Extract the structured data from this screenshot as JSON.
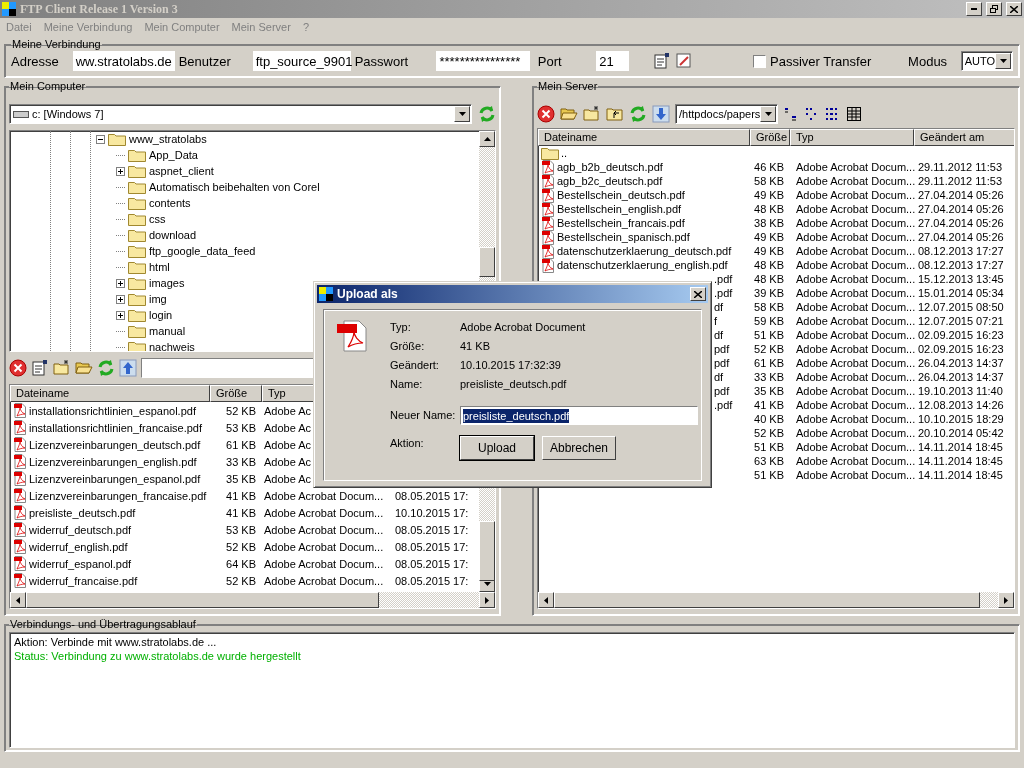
{
  "window": {
    "title": "FTP Client Release 1 Version 3"
  },
  "menu": [
    "Datei",
    "Meine Verbindung",
    "Mein Computer",
    "Mein Server",
    "?"
  ],
  "connection": {
    "title": "Meine Verbindung",
    "address_label": "Adresse",
    "address": "ww.stratolabs.de",
    "user_label": "Benutzer",
    "user": "ftp_source_9901",
    "password_label": "Passwort",
    "password": "****************",
    "port_label": "Port",
    "port": "21",
    "passive_label": "Passiver Transfer",
    "passive": false,
    "mode_label": "Modus",
    "mode": "AUTO"
  },
  "local": {
    "title": "Mein Computer",
    "drive": "c: [Windows 7]",
    "tree": [
      {
        "label": "www_stratolabs",
        "expandable": true,
        "expanded": true,
        "children": [
          {
            "label": "App_Data",
            "expandable": false,
            "expanded": false
          },
          {
            "label": "aspnet_client",
            "expandable": true,
            "expanded": false
          },
          {
            "label": "Automatisch beibehalten von Corel",
            "expandable": false,
            "expanded": false
          },
          {
            "label": "contents",
            "expandable": false,
            "expanded": false
          },
          {
            "label": "css",
            "expandable": false,
            "expanded": false
          },
          {
            "label": "download",
            "expandable": false,
            "expanded": false
          },
          {
            "label": "ftp_google_data_feed",
            "expandable": false,
            "expanded": false
          },
          {
            "label": "html",
            "expandable": false,
            "expanded": false
          },
          {
            "label": "images",
            "expandable": true,
            "expanded": false
          },
          {
            "label": "img",
            "expandable": true,
            "expanded": false
          },
          {
            "label": "login",
            "expandable": true,
            "expanded": false
          },
          {
            "label": "manual",
            "expandable": false,
            "expanded": false
          },
          {
            "label": "nachweis",
            "expandable": false,
            "expanded": false
          }
        ]
      }
    ],
    "columns": [
      "Dateiname",
      "Größe",
      "Typ"
    ],
    "rows": [
      {
        "name": "installationsrichtlinien_espanol.pdf",
        "size": "52 KB",
        "type": "Adobe Ac"
      },
      {
        "name": "installationsrichtlinien_francaise.pdf",
        "size": "53 KB",
        "type": "Adobe Ac"
      },
      {
        "name": "Lizenzvereinbarungen_deutsch.pdf",
        "size": "61 KB",
        "type": "Adobe Ac"
      },
      {
        "name": "Lizenzvereinbarungen_english.pdf",
        "size": "33 KB",
        "type": "Adobe Ac"
      },
      {
        "name": "Lizenzvereinbarungen_espanol.pdf",
        "size": "35 KB",
        "type": "Adobe Ac"
      },
      {
        "name": "Lizenzvereinbarungen_francaise.pdf",
        "size": "41 KB",
        "type": "Adobe Acrobat Docum...",
        "date": "08.05.2015 17:"
      },
      {
        "name": "preisliste_deutsch.pdf",
        "size": "41 KB",
        "type": "Adobe Acrobat Docum...",
        "date": "10.10.2015 17:"
      },
      {
        "name": "widerruf_deutsch.pdf",
        "size": "53 KB",
        "type": "Adobe Acrobat Docum...",
        "date": "08.05.2015 17:"
      },
      {
        "name": "widerruf_english.pdf",
        "size": "52 KB",
        "type": "Adobe Acrobat Docum...",
        "date": "08.05.2015 17:"
      },
      {
        "name": "widerruf_espanol.pdf",
        "size": "64 KB",
        "type": "Adobe Acrobat Docum...",
        "date": "08.05.2015 17:"
      },
      {
        "name": "widerruf_francaise.pdf",
        "size": "52 KB",
        "type": "Adobe Acrobat Docum...",
        "date": "08.05.2015 17:"
      }
    ]
  },
  "server": {
    "title": "Mein Server",
    "path": "/httpdocs/papers",
    "columns": [
      "Dateiname",
      "Größe",
      "Typ",
      "Geändert am"
    ],
    "rows": [
      {
        "kind": "folder",
        "name": ".."
      },
      {
        "kind": "file",
        "name": "agb_b2b_deutsch.pdf",
        "size": "46 KB",
        "type": "Adobe Acrobat Docum...",
        "date": "29.11.2012 11:53"
      },
      {
        "kind": "file",
        "name": "agb_b2c_deutsch.pdf",
        "size": "58 KB",
        "type": "Adobe Acrobat Docum...",
        "date": "29.11.2012 11:53"
      },
      {
        "kind": "file",
        "name": "Bestellschein_deutsch.pdf",
        "size": "49 KB",
        "type": "Adobe Acrobat Docum...",
        "date": "27.04.2014 05:26"
      },
      {
        "kind": "file",
        "name": "Bestellschein_english.pdf",
        "size": "48 KB",
        "type": "Adobe Acrobat Docum...",
        "date": "27.04.2014 05:26"
      },
      {
        "kind": "file",
        "name": "Bestellschein_francais.pdf",
        "size": "38 KB",
        "type": "Adobe Acrobat Docum...",
        "date": "27.04.2014 05:26"
      },
      {
        "kind": "file",
        "name": "Bestellschein_spanisch.pdf",
        "size": "49 KB",
        "type": "Adobe Acrobat Docum...",
        "date": "27.04.2014 05:26"
      },
      {
        "kind": "file",
        "name": "datenschutzerklaerung_deutsch.pdf",
        "size": "49 KB",
        "type": "Adobe Acrobat Docum...",
        "date": "08.12.2013 17:27"
      },
      {
        "kind": "file",
        "name": "datenschutzerklaerung_english.pdf",
        "size": "48 KB",
        "type": "Adobe Acrobat Docum...",
        "date": "08.12.2013 17:27"
      },
      {
        "kind": "covered",
        "name": ".pdf",
        "size": "48 KB",
        "type": "Adobe Acrobat Docum...",
        "date": "15.12.2013 13:45"
      },
      {
        "kind": "covered",
        "name": ".pdf",
        "size": "39 KB",
        "type": "Adobe Acrobat Docum...",
        "date": "15.01.2014 05:34"
      },
      {
        "kind": "covered",
        "name": "df",
        "size": "58 KB",
        "type": "Adobe Acrobat Docum...",
        "date": "12.07.2015 08:50"
      },
      {
        "kind": "covered",
        "name": "f",
        "size": "59 KB",
        "type": "Adobe Acrobat Docum...",
        "date": "12.07.2015 07:21"
      },
      {
        "kind": "covered",
        "name": "df",
        "size": "51 KB",
        "type": "Adobe Acrobat Docum...",
        "date": "02.09.2015 16:23"
      },
      {
        "kind": "covered",
        "name": "pdf",
        "size": "52 KB",
        "type": "Adobe Acrobat Docum...",
        "date": "02.09.2015 16:23"
      },
      {
        "kind": "covered",
        "name": "pdf",
        "size": "61 KB",
        "type": "Adobe Acrobat Docum...",
        "date": "26.04.2013 14:37"
      },
      {
        "kind": "covered",
        "name": "df",
        "size": "33 KB",
        "type": "Adobe Acrobat Docum...",
        "date": "26.04.2013 14:37"
      },
      {
        "kind": "covered",
        "name": "pdf",
        "size": "35 KB",
        "type": "Adobe Acrobat Docum...",
        "date": "19.10.2013 11:40"
      },
      {
        "kind": "covered",
        "name": ".pdf",
        "size": "41 KB",
        "type": "Adobe Acrobat Docum...",
        "date": "12.08.2013 14:26"
      },
      {
        "kind": "covered",
        "size": "40 KB",
        "type": "Adobe Acrobat Docum...",
        "date": "10.10.2015 18:29"
      },
      {
        "kind": "covered",
        "size": "52 KB",
        "type": "Adobe Acrobat Docum...",
        "date": "20.10.2014 05:42"
      },
      {
        "kind": "covered",
        "size": "51 KB",
        "type": "Adobe Acrobat Docum...",
        "date": "14.11.2014 18:45"
      },
      {
        "kind": "covered",
        "size": "63 KB",
        "type": "Adobe Acrobat Docum...",
        "date": "14.11.2014 18:45"
      },
      {
        "kind": "covered",
        "size": "51 KB",
        "type": "Adobe Acrobat Docum...",
        "date": "14.11.2014 18:45"
      }
    ]
  },
  "log": {
    "title": "Verbindungs- und Übertragungsablauf",
    "lines": [
      {
        "text": "Aktion: Verbinde mit www.stratolabs.de ...",
        "color": "#000000"
      },
      {
        "text": "Status: Verbindung zu www.stratolabs.de wurde hergestellt",
        "color": "#00b000"
      }
    ]
  },
  "dialog": {
    "title": "Upload als",
    "fields": [
      {
        "label": "Typ:",
        "value": "Adobe Acrobat Document"
      },
      {
        "label": "Größe:",
        "value": "41 KB"
      },
      {
        "label": "Geändert:",
        "value": "10.10.2015 17:32:39"
      },
      {
        "label": "Name:",
        "value": "preisliste_deutsch.pdf"
      }
    ],
    "new_name_label": "Neuer Name:",
    "new_name": "preisliste_deutsch.pdf",
    "action_label": "Aktion:",
    "buttons": [
      {
        "label": "Upload",
        "default": true
      },
      {
        "label": "Abbrechen",
        "default": false
      }
    ]
  }
}
